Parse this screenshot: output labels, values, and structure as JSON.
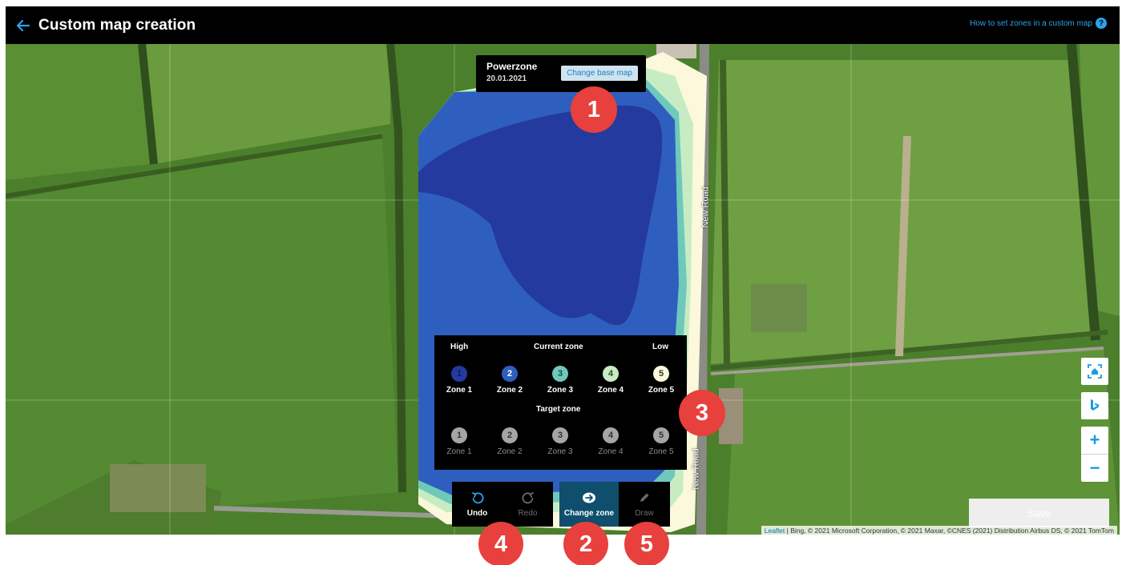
{
  "header": {
    "title": "Custom map creation",
    "help_link": "How to set zones in a custom map",
    "help_icon": "?",
    "back_icon": "arrow-left-icon"
  },
  "basemap": {
    "name": "Powerzone",
    "date": "20.01.2021",
    "change_button": "Change base map"
  },
  "map": {
    "road_label": "New Road",
    "attribution_link": "Leaflet",
    "attribution_text": " | Bing, © 2021 Microsoft Corporation, © 2021 Maxar, ©CNES (2021) Distribution Airbus DS, © 2021 TomTom"
  },
  "zone_panel": {
    "high_label": "High",
    "current_zone_label": "Current zone",
    "low_label": "Low",
    "target_zone_label": "Target zone",
    "current_zones": [
      {
        "num": "1",
        "label": "Zone 1",
        "color": "#253a9e",
        "text_color": "#0c1c6b"
      },
      {
        "num": "2",
        "label": "Zone 2",
        "color": "#2f5fbe",
        "text_color": "#ffffff"
      },
      {
        "num": "3",
        "label": "Zone 3",
        "color": "#6fc9bb",
        "text_color": "#124f47"
      },
      {
        "num": "4",
        "label": "Zone 4",
        "color": "#c7ecc4",
        "text_color": "#2b4a2a"
      },
      {
        "num": "5",
        "label": "Zone 5",
        "color": "#fbf8dc",
        "text_color": "#333333"
      }
    ],
    "target_zones": [
      {
        "num": "1",
        "label": "Zone 1"
      },
      {
        "num": "2",
        "label": "Zone 2"
      },
      {
        "num": "3",
        "label": "Zone 3"
      },
      {
        "num": "4",
        "label": "Zone 4"
      },
      {
        "num": "5",
        "label": "Zone 5"
      }
    ]
  },
  "toolbar": {
    "undo": "Undo",
    "redo": "Redo",
    "change_zone": "Change zone",
    "draw": "Draw"
  },
  "controls": {
    "home_icon": "locate-home-icon",
    "bing_icon": "bing-icon",
    "zoom_in": "+",
    "zoom_out": "−",
    "save": "Save"
  },
  "markers": [
    "1",
    "2",
    "3",
    "4",
    "5"
  ],
  "colors": {
    "accent": "#2aa3ea",
    "marker": "#e8403c",
    "active_tool": "#0f4e6c"
  }
}
